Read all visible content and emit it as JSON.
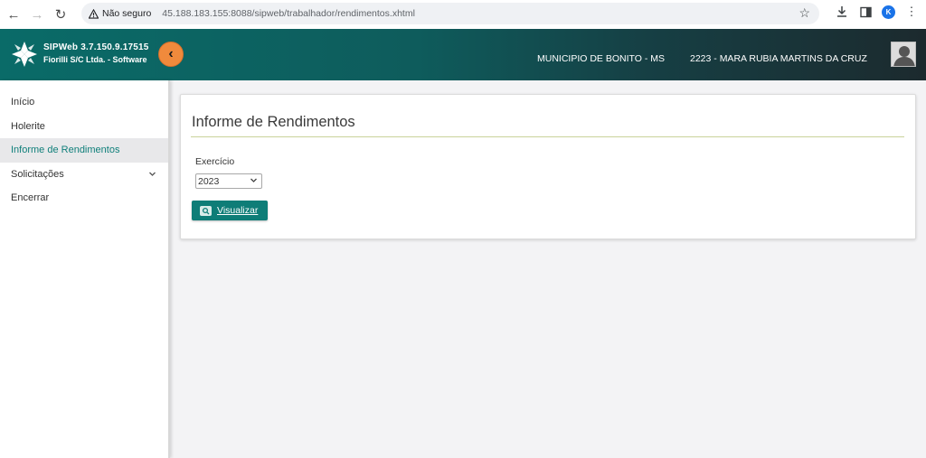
{
  "browser": {
    "security_label": "Não seguro",
    "url": "45.188.183.155:8088/sipweb/trabalhador/rendimentos.xhtml",
    "profile_initial": "K"
  },
  "header": {
    "app_name_version": "SIPWeb  3.7.150.9.17515",
    "company": "Fiorilli S/C Ltda. - Software",
    "organization": "MUNICIPIO DE BONITO - MS",
    "user": "2223 - MARA RUBIA MARTINS DA CRUZ"
  },
  "sidebar": {
    "items": [
      {
        "label": "Início"
      },
      {
        "label": "Holerite"
      },
      {
        "label": "Informe de Rendimentos",
        "active": true
      },
      {
        "label": "Solicitações",
        "has_submenu": true
      },
      {
        "label": "Encerrar"
      }
    ]
  },
  "main": {
    "title": "Informe de Rendimentos",
    "exercicio_label": "Exercício",
    "exercicio_value": "2023",
    "view_button": "Visualizar"
  },
  "colors": {
    "header_start": "#0a6b68",
    "header_end": "#1c2a2e",
    "accent": "#0e7d77",
    "collapse_button": "#f08a3c"
  }
}
